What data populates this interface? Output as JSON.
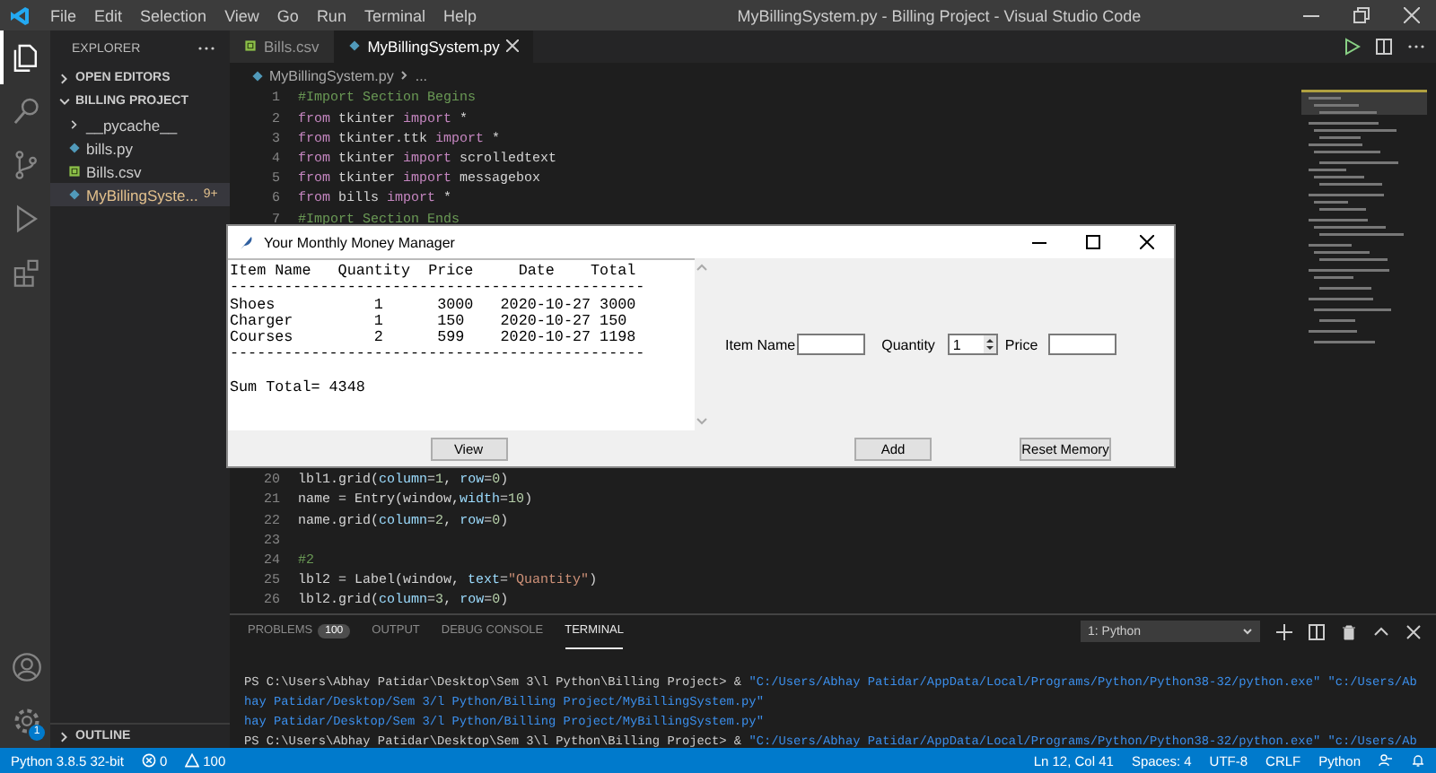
{
  "window": {
    "title": "MyBillingSystem.py - Billing Project - Visual Studio Code"
  },
  "menu": [
    "File",
    "Edit",
    "Selection",
    "View",
    "Go",
    "Run",
    "Terminal",
    "Help"
  ],
  "activity_bar": {
    "items": [
      {
        "kind": "explorer",
        "selected": true
      },
      {
        "kind": "search",
        "selected": false
      },
      {
        "kind": "source-control",
        "selected": false
      },
      {
        "kind": "run",
        "selected": false
      },
      {
        "kind": "extensions",
        "selected": false
      }
    ],
    "bottom": [
      {
        "kind": "account"
      },
      {
        "kind": "settings",
        "badge": "1"
      }
    ]
  },
  "sidebar": {
    "title": "EXPLORER",
    "sections": [
      {
        "label": "OPEN EDITORS",
        "expanded": false
      },
      {
        "label": "BILLING PROJECT",
        "expanded": true
      }
    ],
    "items": [
      {
        "label": "__pycache__",
        "kind": "folder",
        "selected": false
      },
      {
        "label": "bills.py",
        "kind": "python",
        "selected": false
      },
      {
        "label": "Bills.csv",
        "kind": "csv",
        "selected": false
      },
      {
        "label": "MyBillingSyste...",
        "kind": "python",
        "selected": true,
        "badge": "9+"
      }
    ],
    "outline": {
      "label": "OUTLINE",
      "expanded": false
    }
  },
  "tabs": [
    {
      "label": "Bills.csv",
      "kind": "csv",
      "selected": false
    },
    {
      "label": "MyBillingSystem.py",
      "kind": "python",
      "selected": true
    }
  ],
  "breadcrumb": [
    "MyBillingSystem.py",
    "..."
  ],
  "code": [
    {
      "number": "1",
      "tokens": [
        {
          "kind": "comment",
          "text": "#Import Section Begins"
        }
      ]
    },
    {
      "number": "2",
      "tokens": [
        {
          "kind": "keyword",
          "text": "from"
        },
        {
          "kind": "plain",
          "text": " tkinter "
        },
        {
          "kind": "keyword",
          "text": "import"
        },
        {
          "kind": "plain",
          "text": " *"
        }
      ]
    },
    {
      "number": "3",
      "tokens": [
        {
          "kind": "keyword",
          "text": "from"
        },
        {
          "kind": "plain",
          "text": " tkinter.ttk "
        },
        {
          "kind": "keyword",
          "text": "import"
        },
        {
          "kind": "plain",
          "text": " *"
        }
      ]
    },
    {
      "number": "4",
      "tokens": [
        {
          "kind": "keyword",
          "text": "from"
        },
        {
          "kind": "plain",
          "text": " tkinter "
        },
        {
          "kind": "keyword",
          "text": "import"
        },
        {
          "kind": "plain",
          "text": " scrolledtext"
        }
      ]
    },
    {
      "number": "5",
      "tokens": [
        {
          "kind": "keyword",
          "text": "from"
        },
        {
          "kind": "plain",
          "text": " tkinter "
        },
        {
          "kind": "keyword",
          "text": "import"
        },
        {
          "kind": "plain",
          "text": " messagebox"
        }
      ]
    },
    {
      "number": "6",
      "tokens": [
        {
          "kind": "keyword",
          "text": "from"
        },
        {
          "kind": "plain",
          "text": " bills "
        },
        {
          "kind": "keyword",
          "text": "import"
        },
        {
          "kind": "plain",
          "text": " *"
        }
      ]
    },
    {
      "number": "7",
      "tokens": [
        {
          "kind": "comment",
          "text": "#Import Section Ends"
        }
      ]
    },
    {
      "number": "20",
      "tokens": [
        {
          "kind": "plain",
          "text": "lbl1.grid("
        },
        {
          "kind": "param",
          "text": "column"
        },
        {
          "kind": "plain",
          "text": "="
        },
        {
          "kind": "number",
          "text": "1"
        },
        {
          "kind": "plain",
          "text": ", "
        },
        {
          "kind": "param",
          "text": "row"
        },
        {
          "kind": "plain",
          "text": "="
        },
        {
          "kind": "number",
          "text": "0"
        },
        {
          "kind": "plain",
          "text": ")"
        }
      ]
    },
    {
      "number": "21",
      "tokens": [
        {
          "kind": "plain",
          "text": "name = Entry(window,"
        },
        {
          "kind": "param",
          "text": "width"
        },
        {
          "kind": "plain",
          "text": "="
        },
        {
          "kind": "number",
          "text": "10"
        },
        {
          "kind": "plain",
          "text": ")"
        }
      ]
    },
    {
      "number": "22",
      "tokens": [
        {
          "kind": "plain",
          "text": "name.grid("
        },
        {
          "kind": "param",
          "text": "column"
        },
        {
          "kind": "plain",
          "text": "="
        },
        {
          "kind": "number",
          "text": "2"
        },
        {
          "kind": "plain",
          "text": ", "
        },
        {
          "kind": "param",
          "text": "row"
        },
        {
          "kind": "plain",
          "text": "="
        },
        {
          "kind": "number",
          "text": "0"
        },
        {
          "kind": "plain",
          "text": ")"
        }
      ]
    },
    {
      "number": "23"
    },
    {
      "number": "24",
      "tokens": [
        {
          "kind": "comment",
          "text": "#2"
        }
      ]
    },
    {
      "number": "25",
      "tokens": [
        {
          "kind": "plain",
          "text": "lbl2 = Label(window, "
        },
        {
          "kind": "param",
          "text": "text"
        },
        {
          "kind": "plain",
          "text": "="
        },
        {
          "kind": "string",
          "text": "\"Quantity\""
        },
        {
          "kind": "plain",
          "text": ")"
        }
      ]
    },
    {
      "number": "26",
      "tokens": [
        {
          "kind": "plain",
          "text": "lbl2.grid("
        },
        {
          "kind": "param",
          "text": "column"
        },
        {
          "kind": "plain",
          "text": "="
        },
        {
          "kind": "number",
          "text": "3"
        },
        {
          "kind": "plain",
          "text": ", "
        },
        {
          "kind": "param",
          "text": "row"
        },
        {
          "kind": "plain",
          "text": "="
        },
        {
          "kind": "number",
          "text": "0"
        },
        {
          "kind": "plain",
          "text": ")"
        }
      ]
    }
  ],
  "panel": {
    "tabs": [
      {
        "label": "PROBLEMS",
        "badge": "100",
        "selected": false
      },
      {
        "label": "OUTPUT",
        "selected": false
      },
      {
        "label": "DEBUG CONSOLE",
        "selected": false
      },
      {
        "label": "TERMINAL",
        "selected": true
      }
    ],
    "terminal_select": "1: Python",
    "terminal": [
      [
        {
          "kind": "prompt",
          "text": "PS C:\\Users\\Abhay Patidar\\Desktop\\Sem 3\\l Python\\Billing Project> & "
        },
        {
          "kind": "path",
          "text": "\"C:/Users/Abhay Patidar/AppData/Local/Programs/Python/Python38-32/python.exe\" \"c:/Users/Ab"
        }
      ],
      [
        {
          "kind": "path",
          "text": "hay Patidar/Desktop/Sem 3/l Python/Billing Project/MyBillingSystem.py\""
        }
      ],
      [
        {
          "kind": "path",
          "text": "hay Patidar/Desktop/Sem 3/l Python/Billing Project/MyBillingSystem.py\""
        }
      ],
      [
        {
          "kind": "prompt",
          "text": "PS C:\\Users\\Abhay Patidar\\Desktop\\Sem 3\\l Python\\Billing Project> & "
        },
        {
          "kind": "path",
          "text": "\"C:/Users/Abhay Patidar/AppData/Local/Programs/Python/Python38-32/python.exe\" \"c:/Users/Ab"
        }
      ]
    ]
  },
  "status_bar": {
    "left": [
      {
        "kind": "text",
        "text": "Python 3.8.5 32-bit"
      },
      {
        "kind": "errors",
        "text": "0"
      },
      {
        "kind": "warnings",
        "text": "100"
      }
    ],
    "right": [
      "Ln 12, Col 41",
      "Spaces: 4",
      "UTF-8",
      "CRLF",
      "Python"
    ]
  },
  "app_window": {
    "title": "Your Monthly Money Manager",
    "text_lines": [
      {
        "kind": "text",
        "text": "Item Name   Quantity  Price     Date    Total"
      },
      {
        "kind": "rule",
        "text": "----------------------------------------------"
      },
      {
        "kind": "text",
        "text": "Shoes           1      3000   2020-10-27 3000"
      },
      {
        "kind": "text",
        "text": "Charger         1      150    2020-10-27 150"
      },
      {
        "kind": "text",
        "text": "Courses         2      599    2020-10-27 1198"
      },
      {
        "kind": "rule",
        "text": "----------------------------------------------"
      },
      {
        "kind": "total",
        "text": "Sum Total= 4348"
      }
    ],
    "form": {
      "item_name_label": "Item Name",
      "quantity_label": "Quantity",
      "quantity_value": "1",
      "price_label": "Price"
    },
    "buttons": {
      "view": "View",
      "add": "Add",
      "reset": "Reset Memory"
    }
  }
}
